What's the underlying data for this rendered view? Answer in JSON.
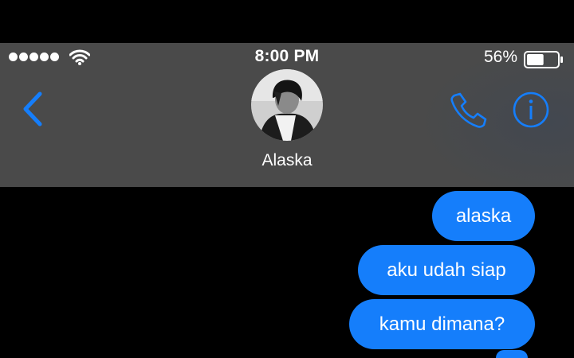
{
  "status_bar": {
    "signal_dots": 5,
    "wifi_icon": "wifi-icon",
    "time": "8:00 PM",
    "battery_percent": "56%",
    "battery_level": 0.56,
    "battery_icon": "battery-icon"
  },
  "header": {
    "back_icon": "chevron-left-icon",
    "contact_name": "Alaska",
    "call_icon": "phone-icon",
    "info_icon": "info-icon"
  },
  "messages": [
    {
      "text": "alaska",
      "direction": "outgoing"
    },
    {
      "text": "aku udah siap",
      "direction": "outgoing"
    },
    {
      "text": "kamu dimana?",
      "direction": "outgoing"
    }
  ],
  "colors": {
    "accent": "#157efb",
    "header_bg": "#4a4a4a",
    "background": "#000000",
    "text": "#ffffff"
  }
}
